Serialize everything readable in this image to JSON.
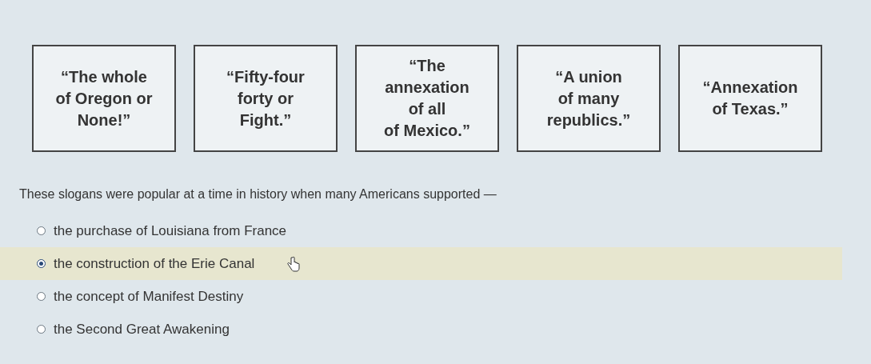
{
  "slogans": [
    {
      "text": "“The whole\nof Oregon or\nNone!”"
    },
    {
      "text": "“Fifty-four\nforty or\nFight.”"
    },
    {
      "text": "“The\nannexation\nof all\nof Mexico.”"
    },
    {
      "text": "“A union\nof many\nrepublics.”"
    },
    {
      "text": "“Annexation\nof Texas.”"
    }
  ],
  "question": "These slogans were popular at a time in history when many Americans supported —",
  "options": [
    {
      "label": "the purchase of Louisiana from France",
      "selected": false
    },
    {
      "label": "the construction of the Erie Canal",
      "selected": true
    },
    {
      "label": "the concept of Manifest Destiny",
      "selected": false
    },
    {
      "label": "the Second Great Awakening",
      "selected": false
    }
  ]
}
